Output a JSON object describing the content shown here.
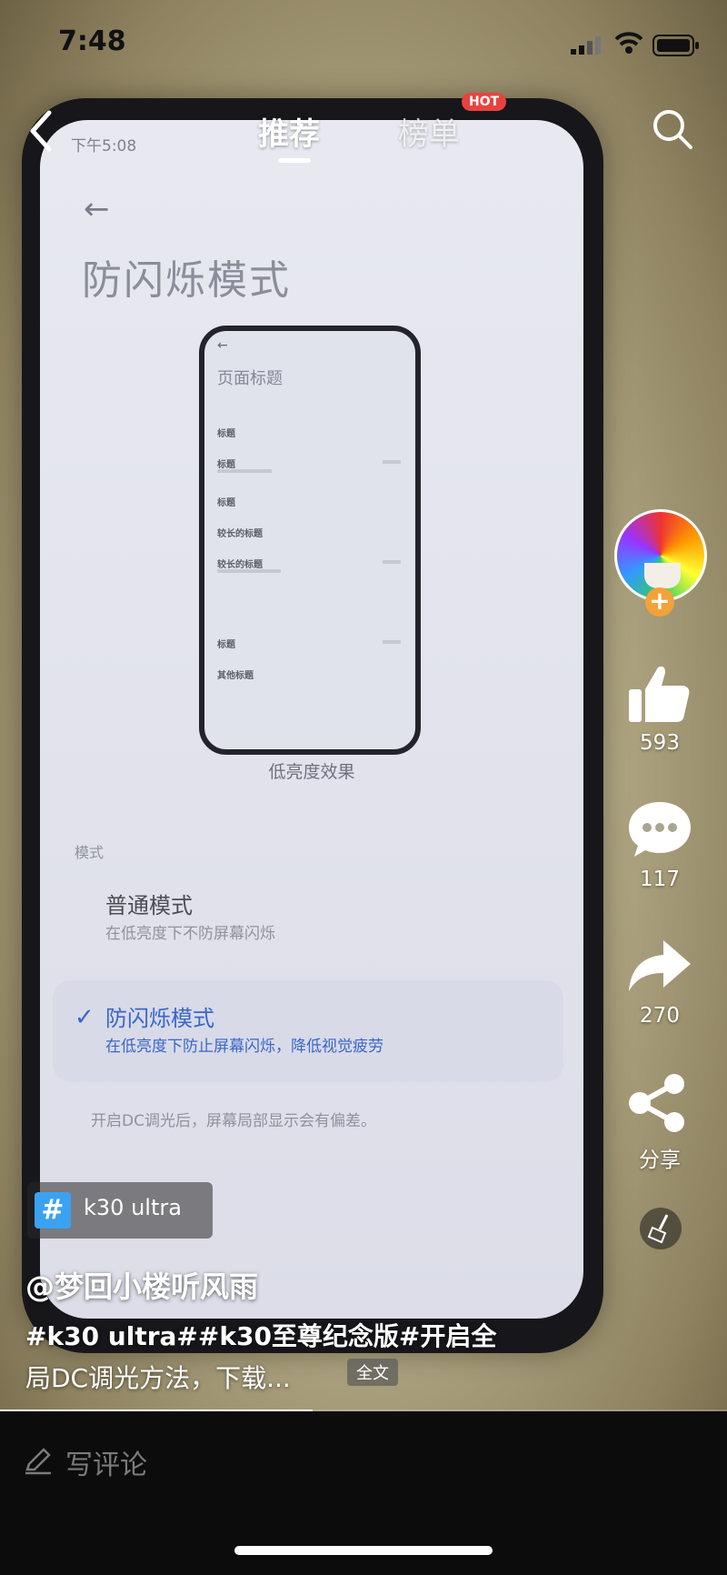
{
  "status": {
    "time": "7:48"
  },
  "nav": {
    "tab_recommend": "推荐",
    "tab_rank": "榜单",
    "hot_badge": "HOT"
  },
  "video": {
    "inner_status_time": "下午5:08",
    "page_title": "防闪烁模式",
    "mini_phone": {
      "title": "页面标题",
      "items": [
        "标题",
        "标题",
        "标题",
        "较长的标题",
        "较长的标题",
        "标题",
        "其他标题"
      ]
    },
    "effect_label": "低亮度效果",
    "mode_label": "模式",
    "normal_mode_title": "普通模式",
    "normal_mode_desc": "在低亮度下不防屏幕闪烁",
    "flicker_mode_title": "防闪烁模式",
    "flicker_mode_desc": "在低亮度下防止屏幕闪烁，降低视觉疲劳",
    "dc_note": "开启DC调光后，屏幕局部显示会有偏差。"
  },
  "rail": {
    "likes": "593",
    "comments": "117",
    "forwards": "270",
    "share_label": "分享"
  },
  "info": {
    "hashtag": "k30 ultra",
    "author": "@梦回小楼听风雨",
    "desc_line1": "#k30 ultra##k30至尊纪念版#开启全",
    "desc_line2": "局DC调光方法，下载...",
    "full_text": "全文",
    "progress": 0.43
  },
  "comment": {
    "placeholder": "写评论"
  }
}
